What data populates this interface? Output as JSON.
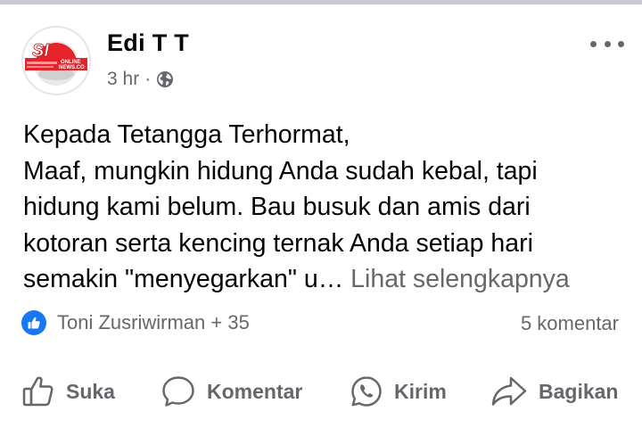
{
  "post": {
    "author": "Edi T T",
    "time": "3 hr",
    "separator": "·",
    "privacy_icon": "globe-icon",
    "more_icon": "more-options-icon",
    "avatar_text_top": "SI",
    "avatar_text_online": "ONLINE",
    "avatar_text_site": "NEWS.CO",
    "body_lines": [
      "Kepada Tetangga Terhormat,",
      "Maaf, mungkin hidung Anda sudah kebal, tapi",
      "hidung kami belum. Bau busuk dan amis dari",
      "kotoran serta kencing ternak Anda setiap hari",
      "semakin \"menyegarkan\" u… "
    ],
    "see_more": "Lihat selengkapnya"
  },
  "reactions": {
    "icon": "like-reaction-icon",
    "names": "Toni Zusriwirman + 35",
    "comments": "5 komentar"
  },
  "actions": {
    "like": "Suka",
    "comment": "Komentar",
    "send": "Kirim",
    "share": "Bagikan"
  },
  "colors": {
    "text_primary": "#050505",
    "text_secondary": "#65676b",
    "like_blue": "#1877f2",
    "avatar_red": "#e4232b"
  }
}
